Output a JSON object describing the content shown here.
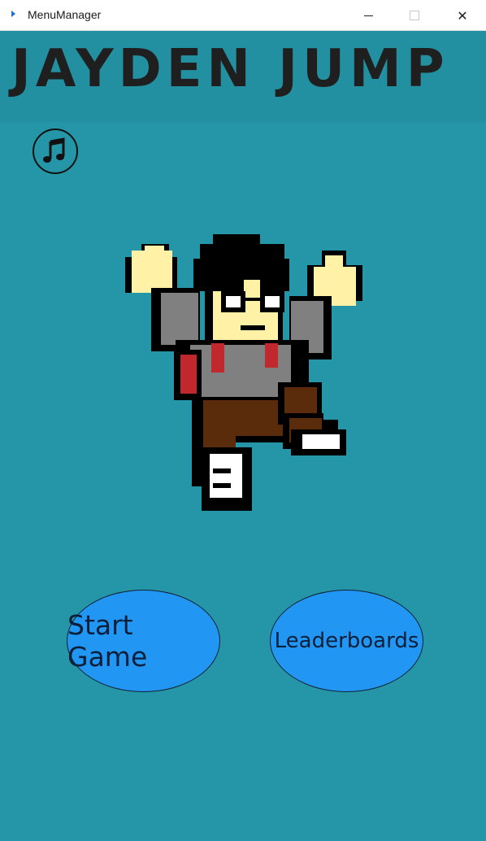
{
  "window": {
    "title": "MenuManager",
    "minimize_symbol": "—",
    "maximize_symbol": "☐",
    "close_symbol": "✕"
  },
  "game": {
    "title": "JAYDEN JUMP",
    "music_icon": "music-note-icon",
    "character": "jumping-pixel-character",
    "buttons": {
      "start": "Start Game",
      "leaderboards": "Leaderboards"
    }
  },
  "colors": {
    "background": "#2596a8",
    "banner": "#2390a2",
    "button": "#2196f3",
    "title": "#1f1f1f"
  }
}
